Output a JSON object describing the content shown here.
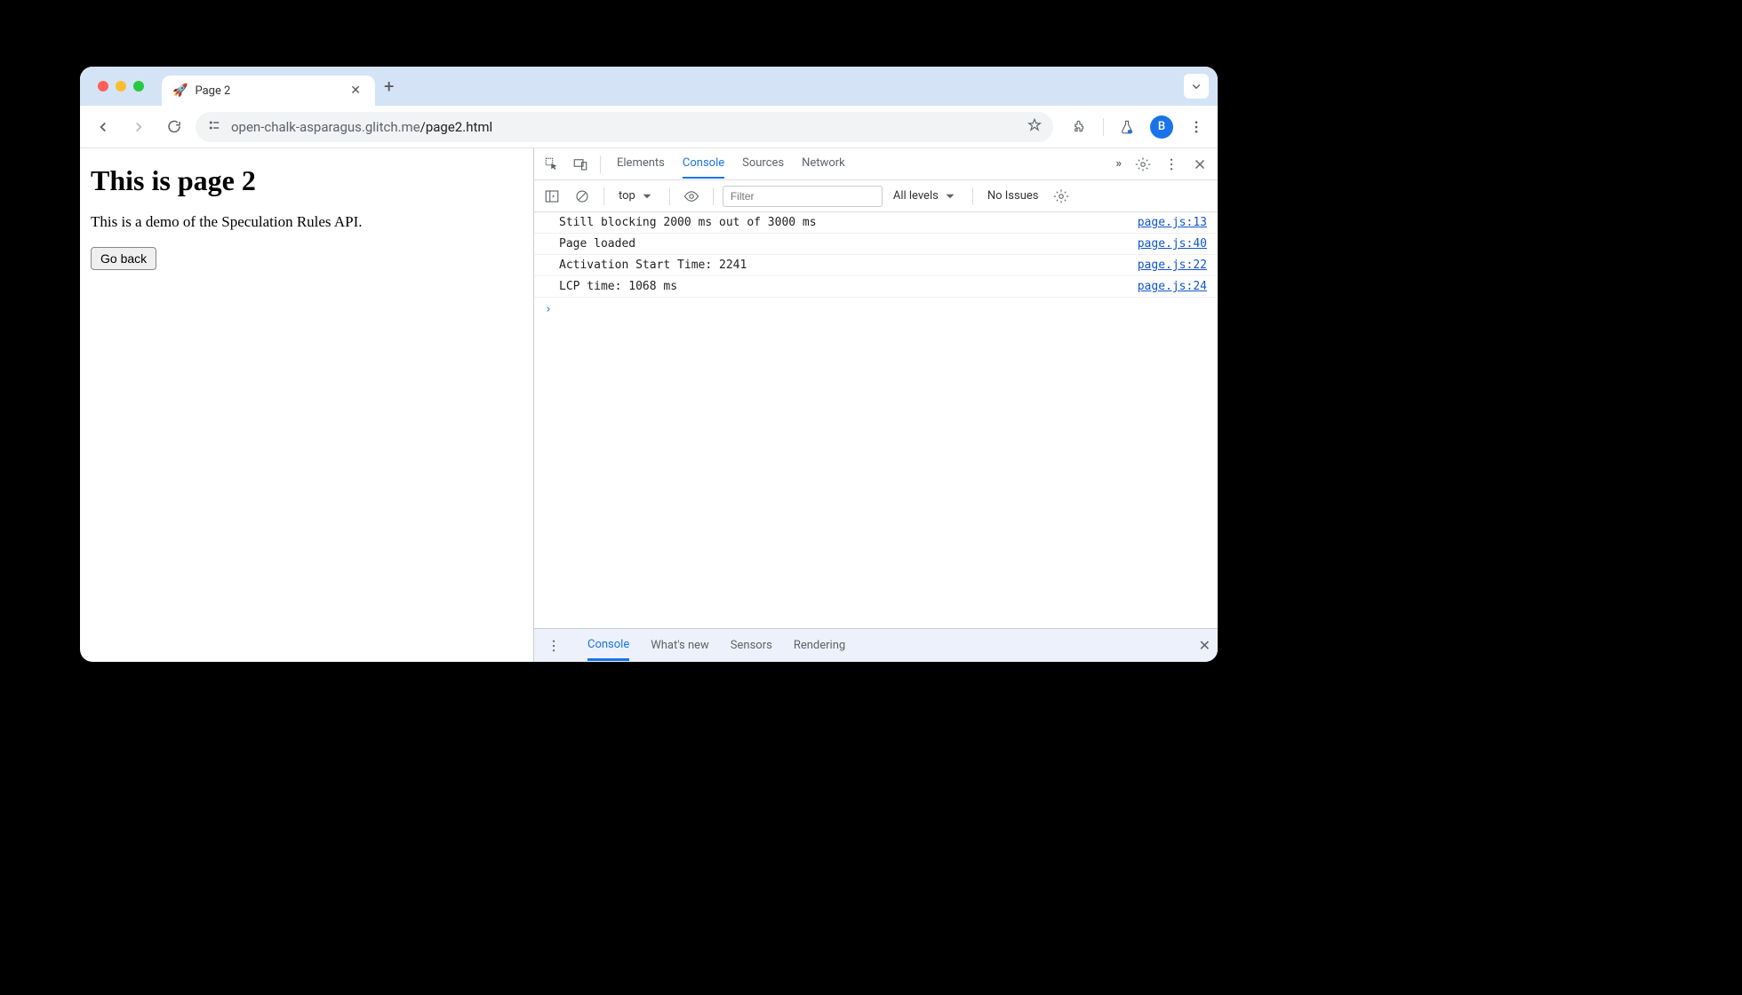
{
  "tab": {
    "favicon": "🚀",
    "title": "Page 2"
  },
  "url": {
    "host": "open-chalk-asparagus.glitch.me",
    "path": "/page2.html"
  },
  "avatar_letter": "B",
  "page": {
    "heading": "This is page 2",
    "description": "This is a demo of the Speculation Rules API.",
    "go_back_label": "Go back"
  },
  "devtools": {
    "tabs": [
      "Elements",
      "Console",
      "Sources",
      "Network"
    ],
    "active_tab": "Console",
    "context": "top",
    "filter_placeholder": "Filter",
    "levels": "All levels",
    "issues": "No Issues",
    "console": [
      {
        "msg": "Still blocking 2000 ms out of 3000 ms",
        "src": "page.js:13"
      },
      {
        "msg": "Page loaded",
        "src": "page.js:40"
      },
      {
        "msg": "Activation Start Time: 2241",
        "src": "page.js:22"
      },
      {
        "msg": "LCP time: 1068 ms",
        "src": "page.js:24"
      }
    ],
    "drawer_tabs": [
      "Console",
      "What's new",
      "Sensors",
      "Rendering"
    ],
    "drawer_active": "Console"
  }
}
